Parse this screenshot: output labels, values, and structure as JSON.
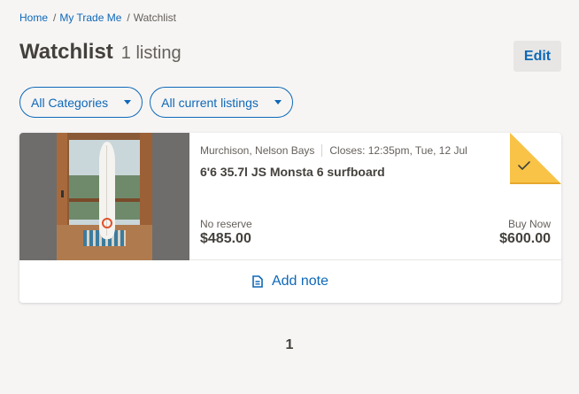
{
  "breadcrumb": {
    "home": "Home",
    "my_trade_me": "My Trade Me",
    "current": "Watchlist",
    "separator": "/"
  },
  "header": {
    "title": "Watchlist",
    "count": "1 listing",
    "edit_label": "Edit"
  },
  "filters": {
    "category": "All Categories",
    "status": "All current listings"
  },
  "listing": {
    "location": "Murchison, Nelson Bays",
    "closes": "Closes: 12:35pm, Tue, 12 Jul",
    "title": "6'6 35.7l JS Monsta 6 surfboard",
    "reserve_label": "No reserve",
    "current_price": "$485.00",
    "buy_now_label": "Buy Now",
    "buy_now_price": "$600.00",
    "watch_badge_color": "#f8c346",
    "add_note_label": "Add note"
  },
  "pagination": {
    "current_page": "1"
  },
  "colors": {
    "accent": "#0e68b8",
    "background": "#f6f5f4",
    "text": "#44413d"
  }
}
